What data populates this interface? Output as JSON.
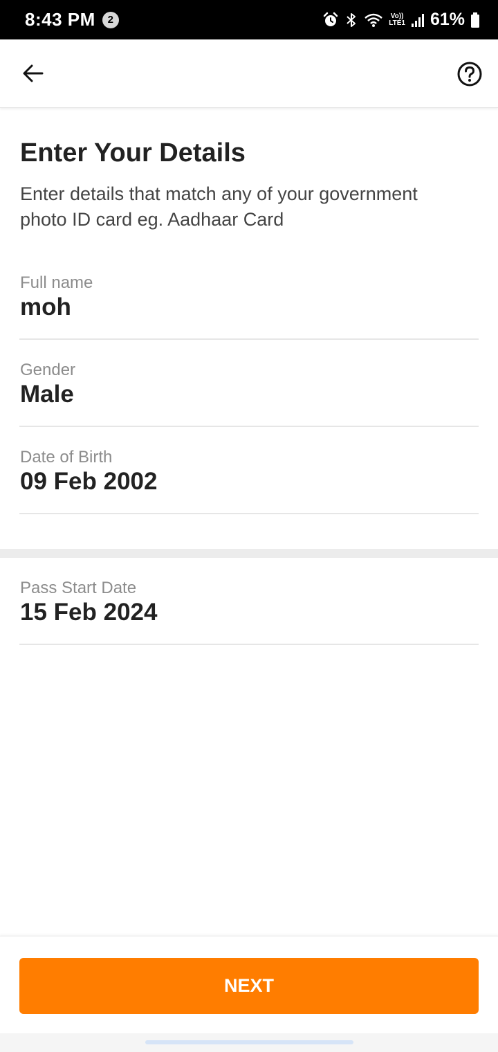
{
  "status_bar": {
    "time": "8:43 PM",
    "notification_count": "2",
    "network_line1": "Vo))",
    "network_line2": "LTE1",
    "battery": "61%",
    "icons": [
      "alarm-icon",
      "bluetooth-icon",
      "wifi-icon",
      "volte-icon",
      "signal-icon",
      "battery-icon"
    ]
  },
  "app_bar": {
    "back_icon": "arrow-left-icon",
    "help_icon": "question-circle-icon"
  },
  "page": {
    "title": "Enter Your Details",
    "subtitle": "Enter details that match any of your government photo ID card eg. Aadhaar Card"
  },
  "fields": [
    {
      "label": "Full name",
      "value": "moh"
    },
    {
      "label": "Gender",
      "value": "Male"
    },
    {
      "label": "Date of Birth",
      "value": "09 Feb 2002"
    }
  ],
  "pass_field": {
    "label": "Pass Start Date",
    "value": "15 Feb 2024"
  },
  "footer": {
    "next_label": "NEXT",
    "accent_color": "#ff7d00"
  }
}
